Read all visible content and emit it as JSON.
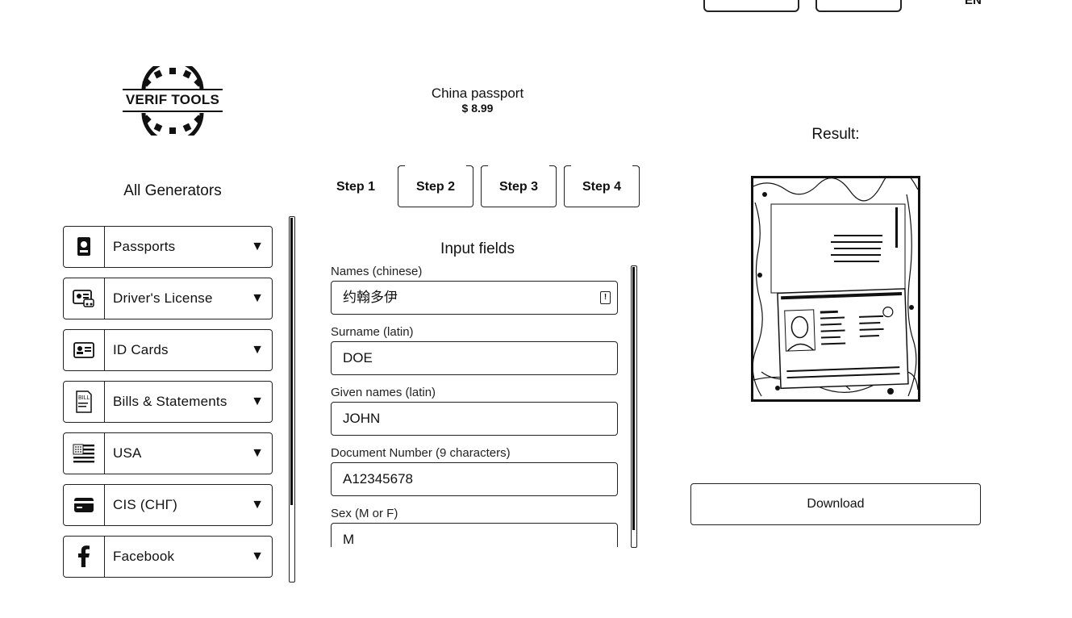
{
  "header": {
    "lang_label": "EN"
  },
  "logo": {
    "text": "VERIF TOOLS"
  },
  "sidebar": {
    "title": "All Generators",
    "items": [
      {
        "label": "Passports",
        "icon": "passport-icon"
      },
      {
        "label": "Driver's License",
        "icon": "drivers-license-icon"
      },
      {
        "label": "ID Cards",
        "icon": "id-card-icon"
      },
      {
        "label": "Bills & Statements",
        "icon": "bill-icon"
      },
      {
        "label": "USA",
        "icon": "us-flag-icon"
      },
      {
        "label": "CIS (СНГ)",
        "icon": "credit-card-icon"
      },
      {
        "label": "Facebook",
        "icon": "facebook-icon"
      }
    ],
    "caret": "▼"
  },
  "product": {
    "title": "China passport",
    "price": "$ 8.99"
  },
  "steps": [
    "Step 1",
    "Step 2",
    "Step 3",
    "Step 4"
  ],
  "form": {
    "title": "Input fields",
    "fields": [
      {
        "label": "Names (chinese)",
        "value": "约翰多伊"
      },
      {
        "label": "Surname (latin)",
        "value": "DOE"
      },
      {
        "label": "Given names (latin)",
        "value": "JOHN"
      },
      {
        "label": "Document Number (9 characters)",
        "value": "A12345678"
      },
      {
        "label": "Sex (M or F)",
        "value": "M"
      }
    ]
  },
  "result": {
    "title": "Result:",
    "download_label": "Download"
  }
}
